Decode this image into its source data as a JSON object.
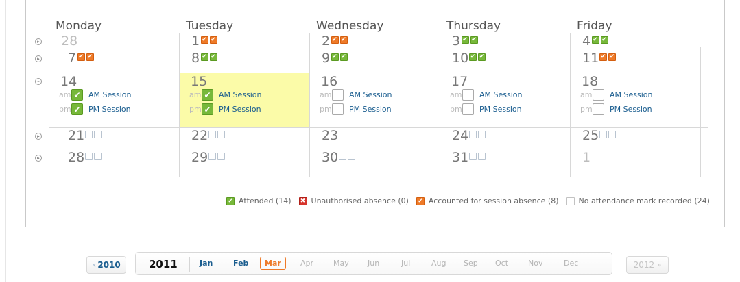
{
  "weekdays": [
    "Monday",
    "Tuesday",
    "Wednesday",
    "Thursday",
    "Friday"
  ],
  "weeks": [
    {
      "days": [
        {
          "num": "28",
          "dim": true,
          "marks": []
        },
        {
          "num": "1",
          "marks": [
            "orange",
            "orange"
          ]
        },
        {
          "num": "2",
          "marks": [
            "orange",
            "orange"
          ]
        },
        {
          "num": "3",
          "marks": [
            "green",
            "green"
          ]
        },
        {
          "num": "4",
          "marks": [
            "green",
            "green"
          ]
        }
      ]
    },
    {
      "days": [
        {
          "num": "7",
          "marks": [
            "orange",
            "orange"
          ]
        },
        {
          "num": "8",
          "marks": [
            "green",
            "green"
          ]
        },
        {
          "num": "9",
          "marks": [
            "green",
            "green"
          ]
        },
        {
          "num": "10",
          "marks": [
            "green",
            "green"
          ]
        },
        {
          "num": "11",
          "marks": [
            "orange",
            "orange"
          ]
        }
      ]
    },
    {
      "expanded": true,
      "days": [
        {
          "num": "14",
          "am_checked": true,
          "pm_checked": true
        },
        {
          "num": "15",
          "today": true,
          "am_checked": true,
          "pm_checked": true
        },
        {
          "num": "16",
          "am_checked": false,
          "pm_checked": false
        },
        {
          "num": "17",
          "am_checked": false,
          "pm_checked": false
        },
        {
          "num": "18",
          "am_checked": false,
          "pm_checked": false
        }
      ]
    },
    {
      "days": [
        {
          "num": "21",
          "marks": [
            "empty",
            "empty"
          ]
        },
        {
          "num": "22",
          "marks": [
            "empty",
            "empty"
          ]
        },
        {
          "num": "23",
          "marks": [
            "empty",
            "empty"
          ]
        },
        {
          "num": "24",
          "marks": [
            "empty",
            "empty"
          ]
        },
        {
          "num": "25",
          "marks": [
            "empty",
            "empty"
          ]
        }
      ]
    },
    {
      "days": [
        {
          "num": "28",
          "marks": [
            "empty",
            "empty"
          ]
        },
        {
          "num": "29",
          "marks": [
            "empty",
            "empty"
          ]
        },
        {
          "num": "30",
          "marks": [
            "empty",
            "empty"
          ]
        },
        {
          "num": "31",
          "marks": [
            "empty",
            "empty"
          ]
        },
        {
          "num": "1",
          "dim": true,
          "marks": []
        }
      ]
    }
  ],
  "session": {
    "am_label": "am",
    "pm_label": "pm",
    "am_text": "AM Session",
    "pm_text": "PM Session"
  },
  "legend": [
    {
      "kind": "green",
      "icon": "check-icon",
      "label": "Attended (14)"
    },
    {
      "kind": "red",
      "icon": "cross-icon",
      "label": "Unauthorised absence (0)"
    },
    {
      "kind": "orange",
      "icon": "check-icon",
      "label": "Accounted for session absence (8)"
    },
    {
      "kind": "empty",
      "icon": "empty-box-icon",
      "label": "No attendance mark recorded (24)"
    }
  ],
  "year_nav": {
    "prev_arrow": "«",
    "prev_year": "2010",
    "current_year": "2011",
    "next_year": "2012",
    "next_arrow": "»",
    "months": [
      {
        "label": "Jan",
        "state": "active"
      },
      {
        "label": "Feb",
        "state": "active"
      },
      {
        "label": "Mar",
        "state": "current"
      },
      {
        "label": "Apr",
        "state": "disabled"
      },
      {
        "label": "May",
        "state": "disabled"
      },
      {
        "label": "Jun",
        "state": "disabled"
      },
      {
        "label": "Jul",
        "state": "disabled"
      },
      {
        "label": "Aug",
        "state": "disabled"
      },
      {
        "label": "Sep",
        "state": "disabled"
      },
      {
        "label": "Oct",
        "state": "disabled"
      },
      {
        "label": "Nov",
        "state": "disabled"
      },
      {
        "label": "Dec",
        "state": "disabled"
      }
    ]
  },
  "colors": {
    "attended": "#77b83a",
    "unauthorised": "#d6342c",
    "accounted": "#ee7a28",
    "today": "#fbfba8",
    "link": "#1a5d8f"
  }
}
